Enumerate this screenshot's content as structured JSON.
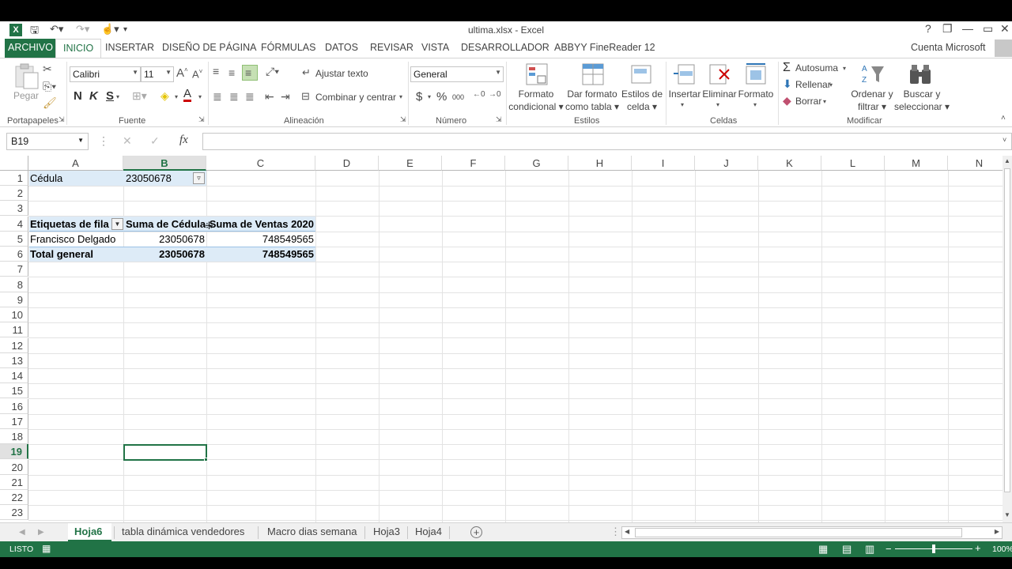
{
  "window": {
    "title": "ultima.xlsx - Excel",
    "help": "?",
    "minimize": "—",
    "restore": "❐",
    "close": "✕"
  },
  "tabs": {
    "archivo": "ARCHIVO",
    "inicio": "INICIO",
    "insertar": "INSERTAR",
    "diseno": "DISEÑO DE PÁGINA",
    "formulas": "FÓRMULAS",
    "datos": "DATOS",
    "revisar": "REVISAR",
    "vista": "VISTA",
    "desarrollador": "DESARROLLADOR",
    "abbyy": "ABBYY FineReader 12",
    "account": "Cuenta Microsoft"
  },
  "ribbon": {
    "portapapeles": {
      "label": "Portapapeles",
      "pegar": "Pegar"
    },
    "fuente": {
      "label": "Fuente",
      "font": "Calibri",
      "size": "11",
      "bold": "N",
      "italic": "K",
      "underline": "S"
    },
    "alineacion": {
      "label": "Alineación",
      "wrap": "Ajustar texto",
      "merge": "Combinar y centrar"
    },
    "numero": {
      "label": "Número",
      "format": "General",
      "currency": "$",
      "percent": "%",
      "thousands": "000"
    },
    "estilos": {
      "label": "Estilos",
      "cond1": "Formato",
      "cond2": "condicional",
      "table1": "Dar formato",
      "table2": "como tabla",
      "cell1": "Estilos de",
      "cell2": "celda"
    },
    "celdas": {
      "label": "Celdas",
      "insert": "Insertar",
      "delete": "Eliminar",
      "format": "Formato"
    },
    "modificar": {
      "label": "Modificar",
      "autosum": "Autosuma",
      "fill": "Rellenar",
      "clear": "Borrar",
      "sort1": "Ordenar y",
      "sort2": "filtrar",
      "find1": "Buscar y",
      "find2": "seleccionar"
    }
  },
  "formula_bar": {
    "name_box": "B19",
    "fx": "fx",
    "formula": ""
  },
  "grid": {
    "columns": [
      "A",
      "B",
      "C",
      "D",
      "E",
      "F",
      "G",
      "H",
      "I",
      "J",
      "K",
      "L",
      "M",
      "N"
    ],
    "rows": [
      "1",
      "2",
      "3",
      "4",
      "5",
      "6",
      "7",
      "8",
      "9",
      "10",
      "11",
      "12",
      "13",
      "14",
      "15",
      "16",
      "17",
      "18",
      "19",
      "20",
      "21",
      "22",
      "23"
    ],
    "cells": {
      "a1": "Cédula",
      "b1": "23050678",
      "a3": "Etiquetas de fila",
      "b3": "Suma de Cédula",
      "c3": "Suma de Ventas 2020",
      "a4": "Francisco Delgado",
      "b4": "23050678",
      "c4": "748549565",
      "a5": "Total general",
      "b5": "23050678",
      "c5": "748549565"
    }
  },
  "sheets": [
    "Hoja6",
    "tabla dinámica vendedores",
    "Macro dias semana",
    "Hoja3",
    "Hoja4"
  ],
  "status": {
    "mode": "LISTO",
    "zoom": "100%"
  },
  "colors": {
    "accent": "#217346",
    "pivot_header": "#ddebf7",
    "selected_header": "#e1e1e1"
  }
}
